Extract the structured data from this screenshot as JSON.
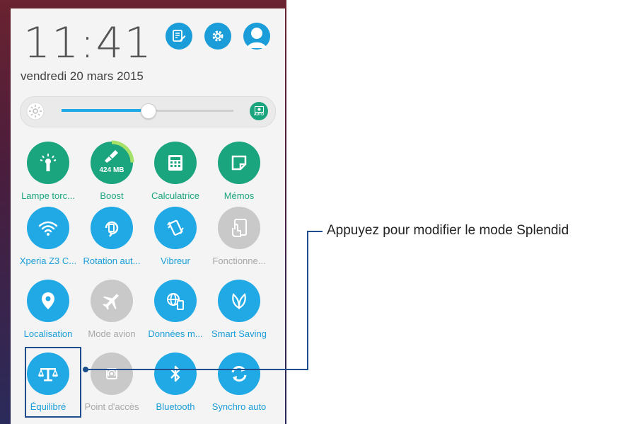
{
  "header": {
    "time": "11:41",
    "date": "vendredi 20 mars 2015"
  },
  "top_icons": [
    "edit-icon",
    "gear-icon",
    "avatar"
  ],
  "brightness": {
    "level_fraction": 0.5,
    "auto_label": "AUTO"
  },
  "tiles": [
    {
      "label": "Lampe torc...",
      "icon": "flashlight-icon",
      "state": "on-green"
    },
    {
      "label": "Boost",
      "icon": "broom-icon",
      "state": "on-green",
      "value": "424 MB"
    },
    {
      "label": "Calculatrice",
      "icon": "calculator-icon",
      "state": "on-green"
    },
    {
      "label": "Mémos",
      "icon": "memo-icon",
      "state": "on-green"
    },
    {
      "label": "Xperia Z3 C...",
      "icon": "wifi-icon",
      "state": "on-blue"
    },
    {
      "label": "Rotation aut...",
      "icon": "rotation-icon",
      "state": "on-blue"
    },
    {
      "label": "Vibreur",
      "icon": "vibrate-icon",
      "state": "on-blue"
    },
    {
      "label": "Fonctionne...",
      "icon": "touch-icon",
      "state": "off"
    },
    {
      "label": "Localisation",
      "icon": "location-icon",
      "state": "on-blue"
    },
    {
      "label": "Mode avion",
      "icon": "airplane-icon",
      "state": "off"
    },
    {
      "label": "Données m...",
      "icon": "mobile-data-icon",
      "state": "on-blue"
    },
    {
      "label": "Smart Saving",
      "icon": "leaf-icon",
      "state": "on-blue"
    },
    {
      "label": "Équilibré",
      "icon": "balance-icon",
      "state": "on-blue"
    },
    {
      "label": "Point d'accès",
      "icon": "hotspot-icon",
      "state": "off"
    },
    {
      "label": "Bluetooth",
      "icon": "bluetooth-icon",
      "state": "on-blue"
    },
    {
      "label": "Synchro auto",
      "icon": "sync-icon",
      "state": "on-blue"
    }
  ],
  "callout": {
    "text": "Appuyez pour modifier le mode Splendid"
  },
  "colors": {
    "green": "#1ba57f",
    "blue": "#21a9e6",
    "off": "#c9c9c9",
    "highlight": "#1f4e8c"
  }
}
